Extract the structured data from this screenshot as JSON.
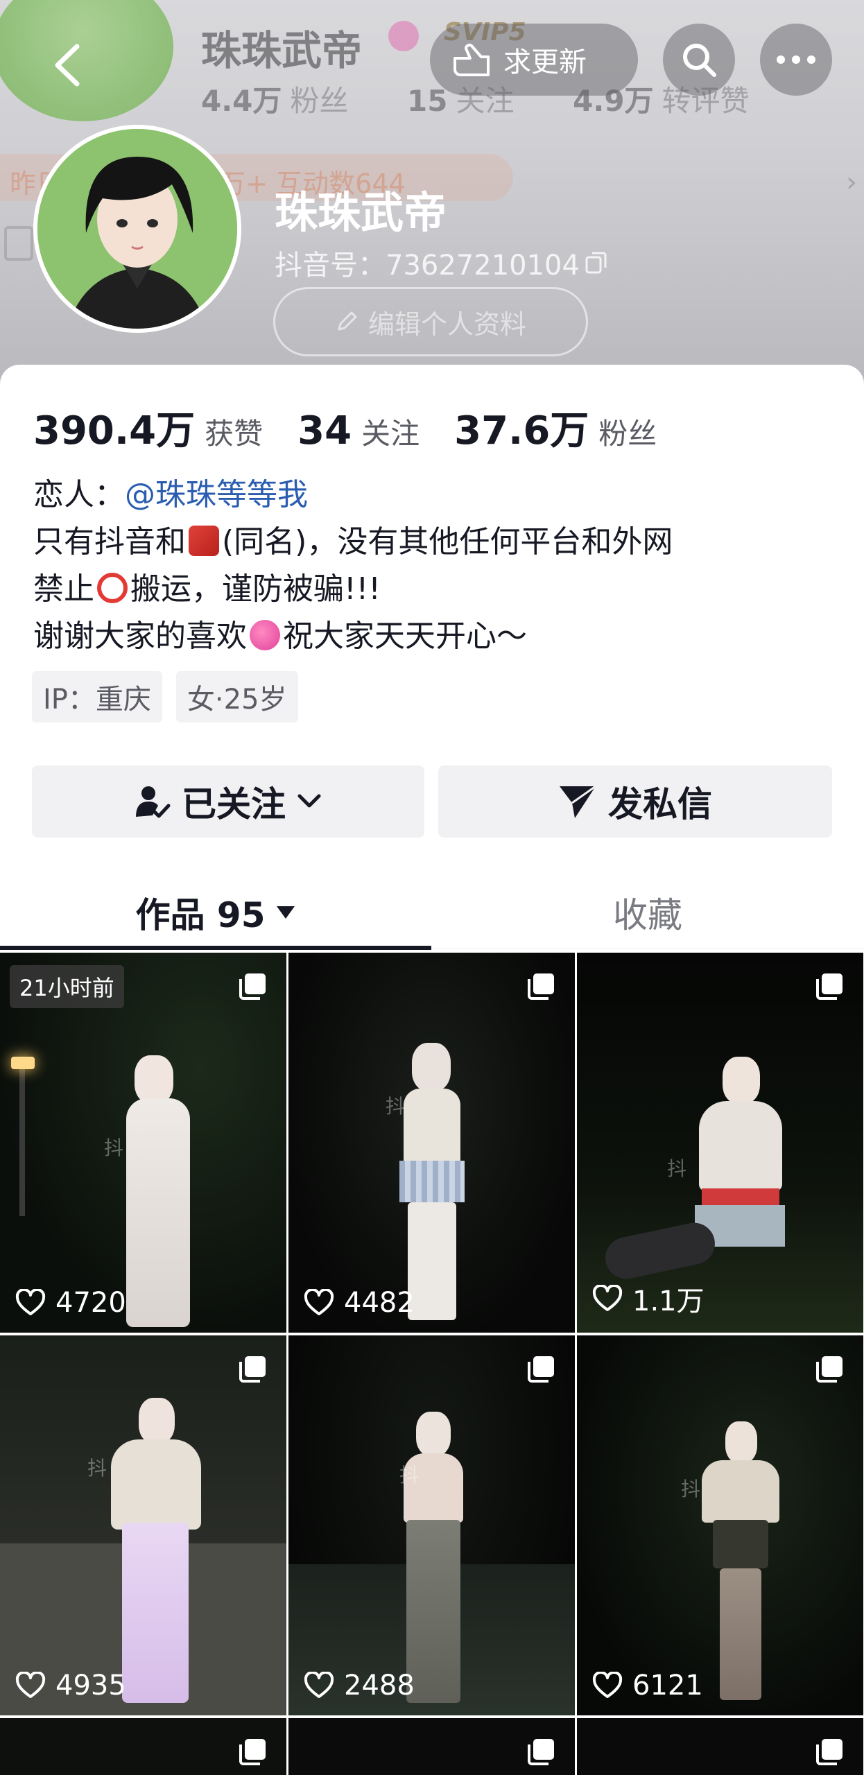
{
  "header": {
    "ghost": {
      "name": "珠珠武帝",
      "svip": "SVIP5",
      "fans": "4.4万",
      "fans_label": "粉丝",
      "following": "15",
      "following_label": "关注",
      "reposts": "4.9万",
      "reposts_label": "转评赞",
      "pill": "昨日 新增粉丝数1万+   互动数644"
    },
    "update_label": "求更新",
    "name": "珠珠武帝",
    "douyin_id": "抖音号：73627210104",
    "edit_label": "编辑个人资料"
  },
  "stats": [
    {
      "value": "390.4万",
      "label": "获赞"
    },
    {
      "value": "34",
      "label": "关注"
    },
    {
      "value": "37.6万",
      "label": "粉丝"
    }
  ],
  "bio": {
    "line1_prefix": "恋人：",
    "mention": "@珠珠等等我",
    "line2a": "只有抖音和",
    "line2b": "(同名)，没有其他任何平台和外网",
    "line3a": "禁止",
    "line3b": "搬运，谨防被骗!!!",
    "line4a": "谢谢大家的喜欢",
    "line4b": "祝大家天天开心～"
  },
  "tags": [
    "IP：重庆",
    "女·25岁"
  ],
  "actions": {
    "follow_label": "已关注",
    "message_label": "发私信"
  },
  "tabs": {
    "works_label": "作品 95",
    "favorites_label": "收藏"
  },
  "videos": [
    {
      "likes": "4720",
      "time_badge": "21小时前"
    },
    {
      "likes": "4482"
    },
    {
      "likes": "1.1万"
    },
    {
      "likes": "4935"
    },
    {
      "likes": "2488"
    },
    {
      "likes": "6121"
    }
  ],
  "colors": {
    "accent_link": "#2a5db0",
    "text_primary": "#161823",
    "button_bg": "#f1f1f3"
  }
}
